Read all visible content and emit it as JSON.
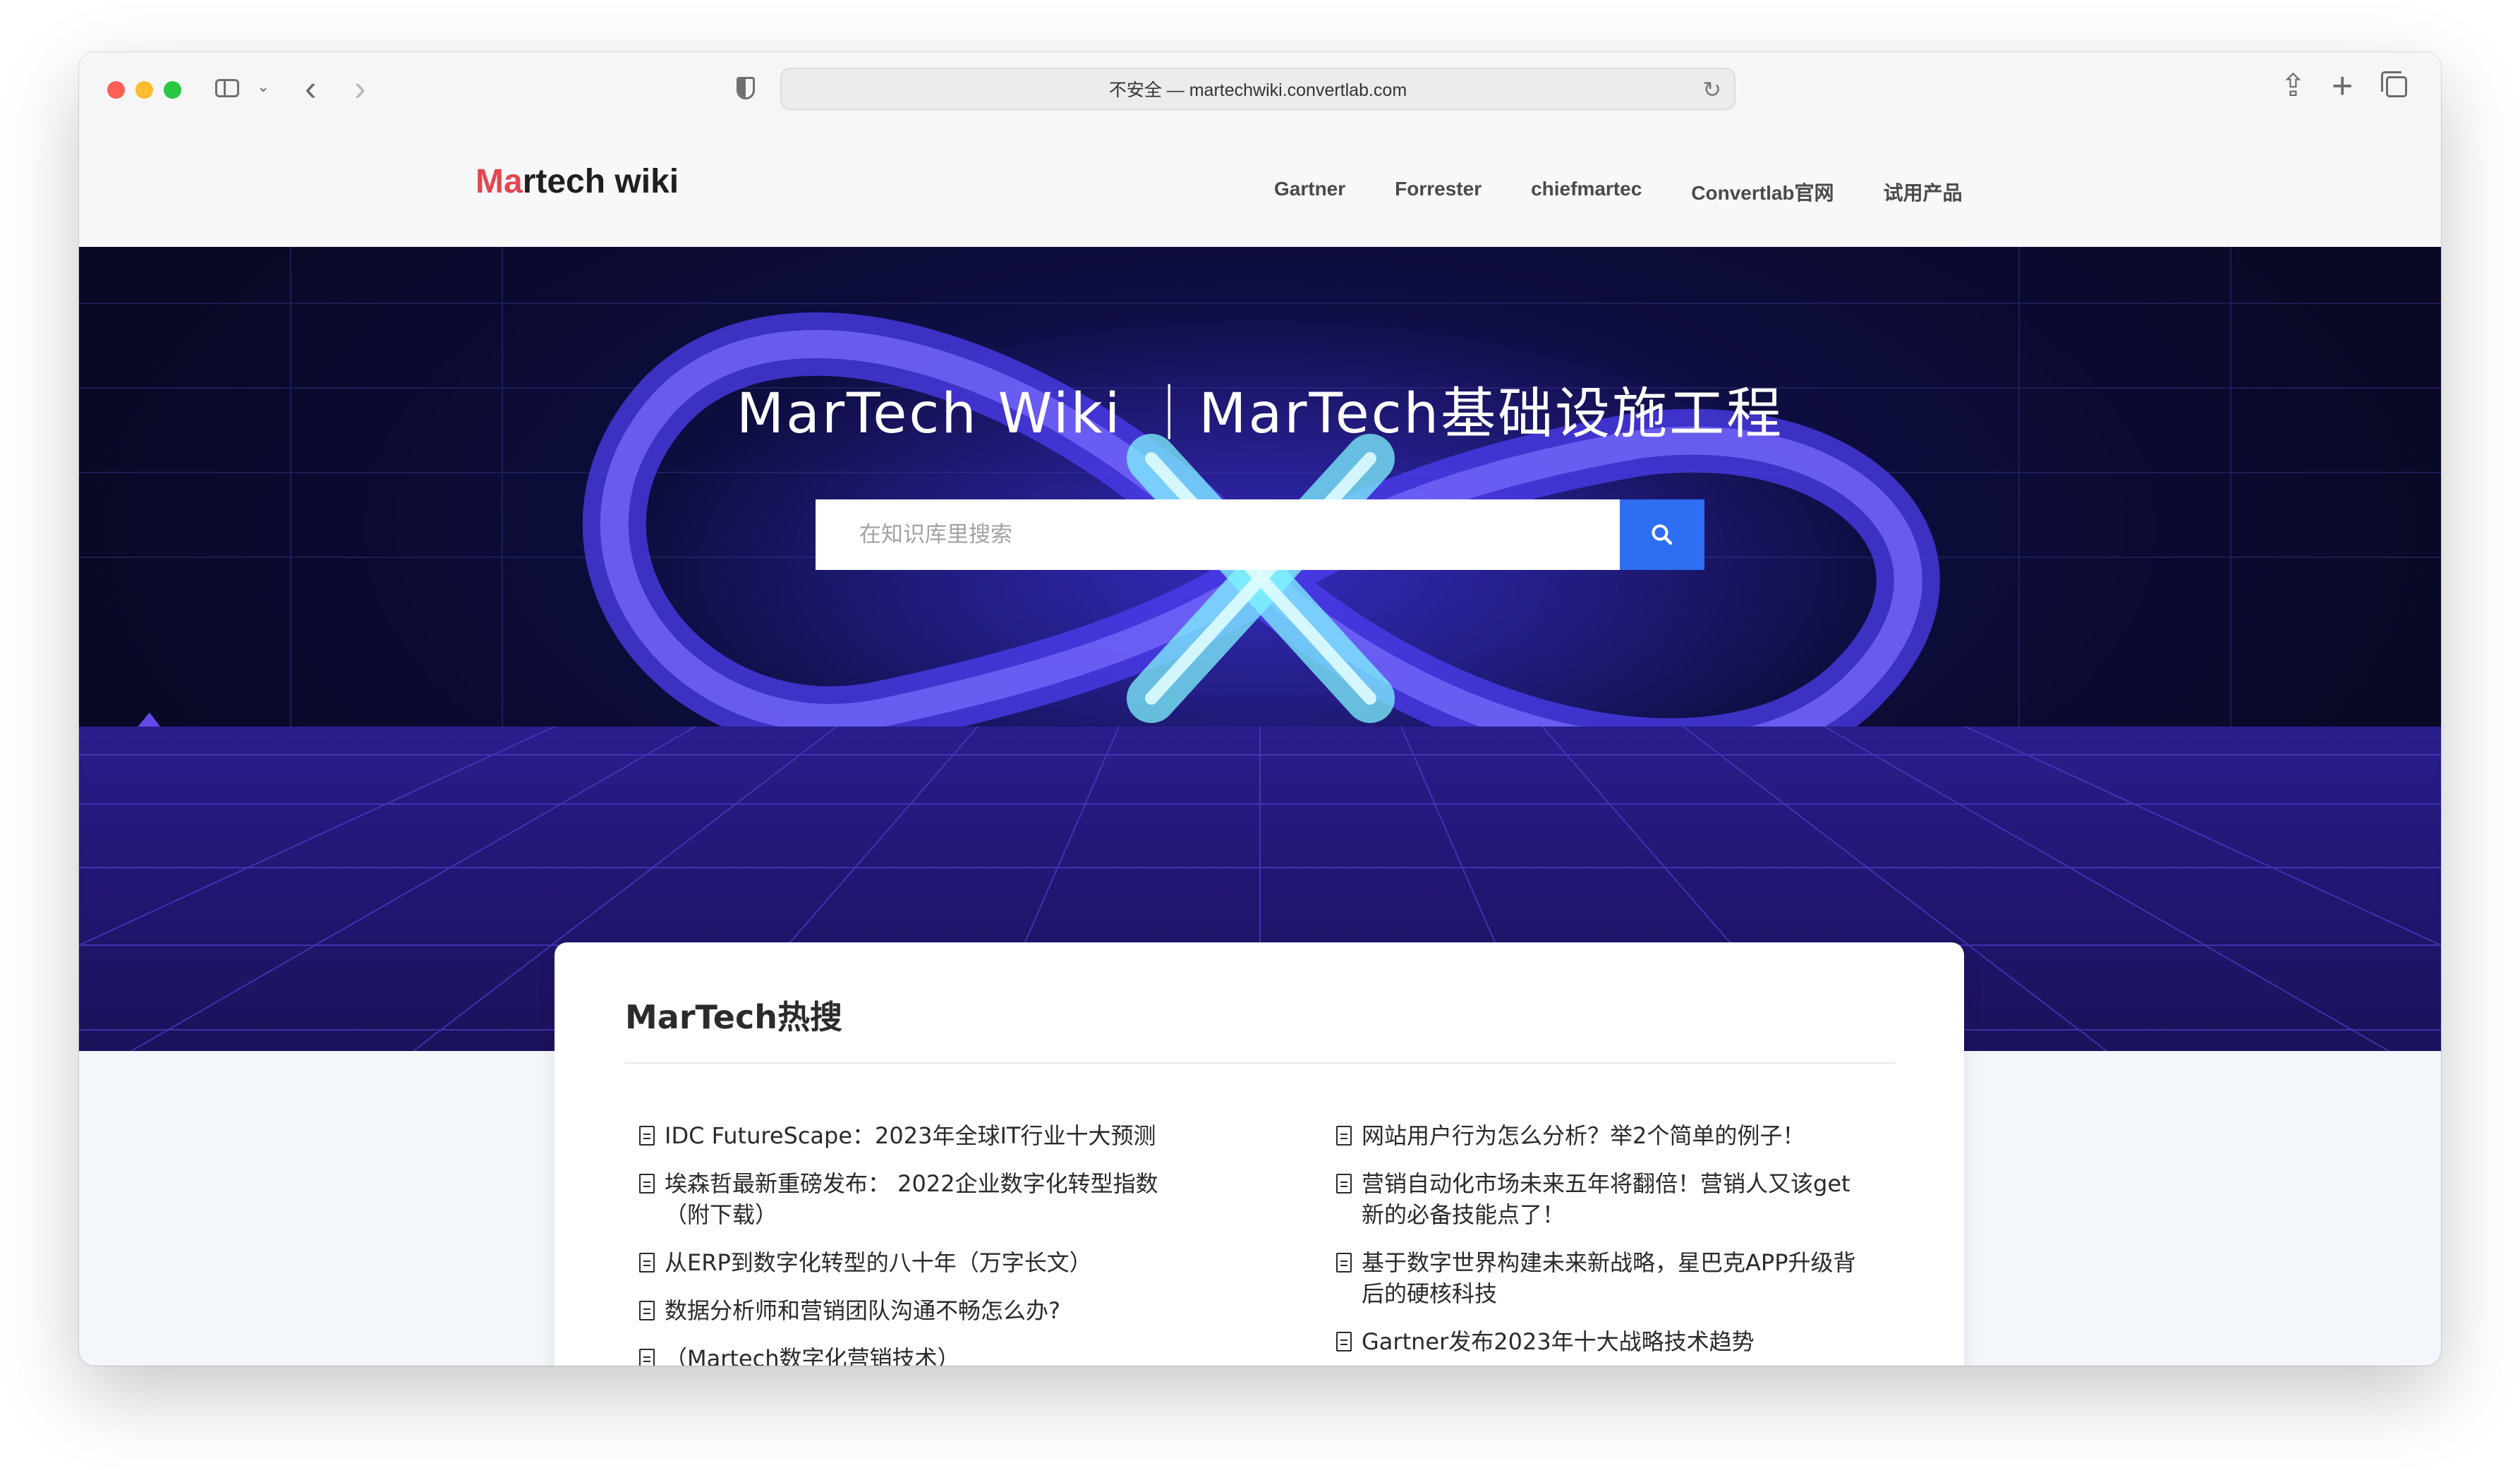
{
  "browser": {
    "url_text": "不安全 — martechwiki.convertlab.com",
    "icons": [
      "sidebar-icon",
      "chevron-down-icon",
      "back-icon",
      "forward-icon",
      "shield-icon",
      "reload-icon",
      "share-icon",
      "new-tab-icon",
      "tab-overview-icon"
    ]
  },
  "site": {
    "logo_accent": "Ma",
    "logo_rest": "rtech wiki",
    "nav": [
      "Gartner",
      "Forrester",
      "chiefmartec",
      "Convertlab官网",
      "试用产品"
    ]
  },
  "hero": {
    "title": "MarTech Wiki ｜MarTech基础设施工程",
    "search_placeholder": "在知识库里搜索",
    "search_icon": "search-icon"
  },
  "hot": {
    "title": "MarTech热搜",
    "left": [
      "IDC FutureScape：2023年全球IT行业十大预测",
      "埃森哲最新重磅发布： 2022企业数字化转型指数（附下载）",
      "从ERP到数字化转型的八十年（万字长文）",
      "数据分析师和营销团队沟通不畅怎么办?",
      "（Martech数字化营销技术）"
    ],
    "right": [
      "网站用户行为怎么分析？举2个简单的例子！",
      "营销自动化市场未来五年将翻倍！营销人又该get新的必备技能点了！",
      "基于数字世界构建未来新战略，星巴克APP升级背后的硬核科技",
      "Gartner发布2023年十大战略技术趋势"
    ]
  },
  "colors": {
    "accent": "#e4464f",
    "search_button": "#2e6ef2",
    "hero_bg": "#0c0c3a"
  }
}
